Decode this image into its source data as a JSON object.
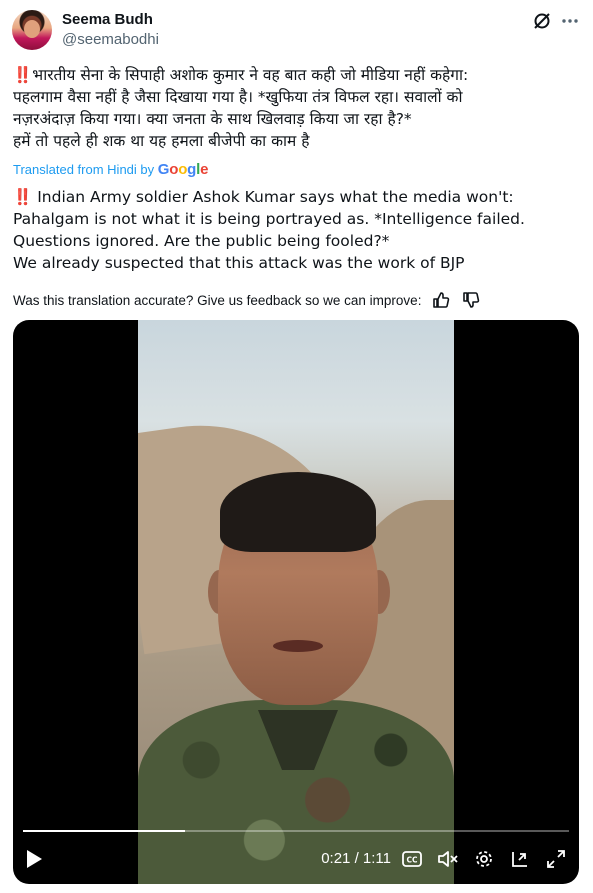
{
  "author": {
    "display_name": "Seema Budh",
    "handle": "@seemabodhi",
    "avatar_icon": "profile-photo"
  },
  "icons": {
    "grok": "grok-icon",
    "more": "more-icon",
    "thumbs_up": "thumbs-up-icon",
    "thumbs_down": "thumbs-down-icon"
  },
  "post": {
    "hindi_lines": [
      "‼️भारतीय सेना के सिपाही अशोक कुमार ने वह बात कही जो मीडिया नहीं कहेगा:",
      "पहलगाम वैसा नहीं है जैसा दिखाया गया है। *खुफिया तंत्र विफल रहा। सवालों को",
      "नज़रअंदाज़ किया गया। क्या जनता के साथ खिलवाड़ किया जा रहा है?*",
      "हमें तो पहले ही शक था यह हमला बीजेपी का काम है"
    ],
    "translated_prefix": "Translated from Hindi by",
    "translated_brand": "Google",
    "english_lines": [
      "‼️ Indian Army soldier Ashok Kumar says what the media won't:",
      "Pahalgam is not what it is being portrayed as. *Intelligence failed.",
      "Questions ignored. Are the public being fooled?*",
      "We already suspected that this attack was the work of BJP"
    ],
    "feedback_prompt": "Was this translation accurate? Give us feedback so we can improve:"
  },
  "video": {
    "current_time": "0:21",
    "separator": "/",
    "duration": "1:11",
    "progress_fraction": 0.296,
    "controls": [
      "play-icon",
      "captions-icon",
      "mute-icon",
      "settings-icon",
      "pip-icon",
      "fullscreen-icon"
    ]
  },
  "colors": {
    "link_blue": "#1d9bf0",
    "text_primary": "#0f1419",
    "text_secondary": "#536471"
  }
}
